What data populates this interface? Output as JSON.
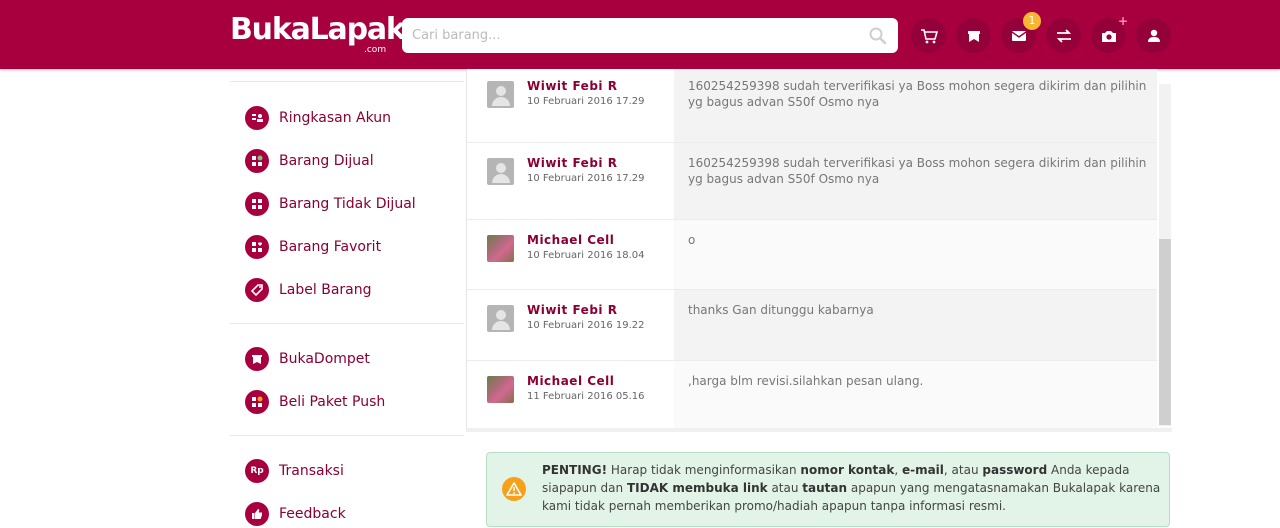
{
  "header": {
    "logo_text": "BukaLapak",
    "logo_suffix": ".com",
    "search_placeholder": "Cari barang...",
    "notification_count": "1",
    "brand_color": "#a8003f"
  },
  "sidebar": {
    "group1": [
      {
        "label": "Ringkasan Akun",
        "icon": "account-summary-icon"
      },
      {
        "label": "Barang Dijual",
        "icon": "products-sold-icon"
      },
      {
        "label": "Barang Tidak Dijual",
        "icon": "products-unsold-icon"
      },
      {
        "label": "Barang Favorit",
        "icon": "favorite-products-icon"
      },
      {
        "label": "Label Barang",
        "icon": "tag-icon"
      }
    ],
    "group2": [
      {
        "label": "BukaDompet",
        "icon": "wallet-icon"
      },
      {
        "label": "Beli Paket Push",
        "icon": "push-package-icon"
      }
    ],
    "group3": [
      {
        "label": "Transaksi",
        "icon": "rp-icon",
        "icon_text": "Rp"
      },
      {
        "label": "Feedback",
        "icon": "thumbs-up-icon"
      }
    ]
  },
  "messages": [
    {
      "name": "Wiwit Febi R",
      "date": "10 Februari 2016 17.29",
      "text": "160254259398 sudah terverifikasi ya Boss mohon segera dikirim dan pilihin yg bagus advan S50f Osmo nya",
      "avatar": "default"
    },
    {
      "name": "Wiwit Febi R",
      "date": "10 Februari 2016 17.29",
      "text": "160254259398 sudah terverifikasi ya Boss mohon segera dikirim dan pilihin yg bagus advan S50f Osmo nya",
      "avatar": "default"
    },
    {
      "name": "Michael Cell",
      "date": "10 Februari 2016 18.04",
      "text": "o",
      "avatar": "photo"
    },
    {
      "name": "Wiwit Febi R",
      "date": "10 Februari 2016 19.22",
      "text": "thanks Gan ditunggu kabarnya",
      "avatar": "default"
    },
    {
      "name": "Michael Cell",
      "date": "11 Februari 2016 05.16",
      "text": ",harga blm revisi.silahkan pesan ulang.",
      "avatar": "photo"
    }
  ],
  "alert": {
    "p1": "PENTING!",
    "p2": " Harap tidak menginformasikan ",
    "p3": "nomor kontak",
    "p4": ", ",
    "p5": "e-mail",
    "p6": ", atau ",
    "p7": "password",
    "p8": " Anda kepada siapapun dan ",
    "p9": "TIDAK membuka link",
    "p10": " atau ",
    "p11": "tautan",
    "p12": " apapun yang mengatasnamakan Bukalapak karena kami tidak pernah memberikan promo/hadiah apapun tanpa informasi resmi."
  }
}
